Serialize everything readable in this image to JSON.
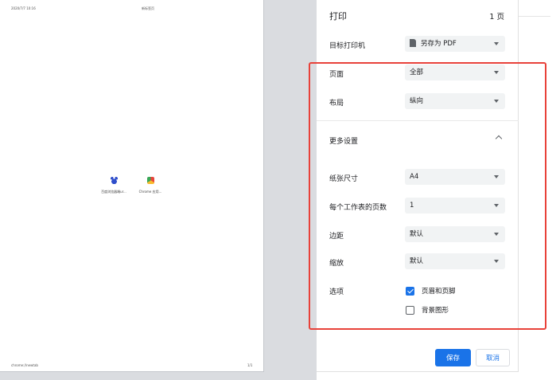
{
  "preview": {
    "header_date": "2020/7/7 10:16",
    "header_title": "新标签页",
    "footer_url": "chrome://newtab",
    "footer_page": "1/1",
    "shortcuts": [
      {
        "label": "百度浏览器端ur..."
      },
      {
        "label": "Chrome 应用..."
      }
    ]
  },
  "panel": {
    "title": "打印",
    "page_count": "1 页",
    "destination": {
      "label": "目标打印机",
      "value": "另存为 PDF",
      "icon": "pdf-file-icon"
    },
    "pages": {
      "label": "页面",
      "value": "全部"
    },
    "layout": {
      "label": "布局",
      "value": "纵向"
    },
    "more_settings": {
      "label": "更多设置"
    },
    "paper_size": {
      "label": "纸张尺寸",
      "value": "A4"
    },
    "pages_per_sheet": {
      "label": "每个工作表的页数",
      "value": "1"
    },
    "margins": {
      "label": "边距",
      "value": "默认"
    },
    "scale": {
      "label": "缩放",
      "value": "默认"
    },
    "options": {
      "label": "选项",
      "headers_footers": {
        "label": "页眉和页脚",
        "checked": true
      },
      "background_graphics": {
        "label": "背景图形",
        "checked": false
      }
    },
    "save_label": "保存",
    "cancel_label": "取消"
  },
  "colors": {
    "accent": "#1a73e8",
    "highlight": "#e8423a"
  }
}
